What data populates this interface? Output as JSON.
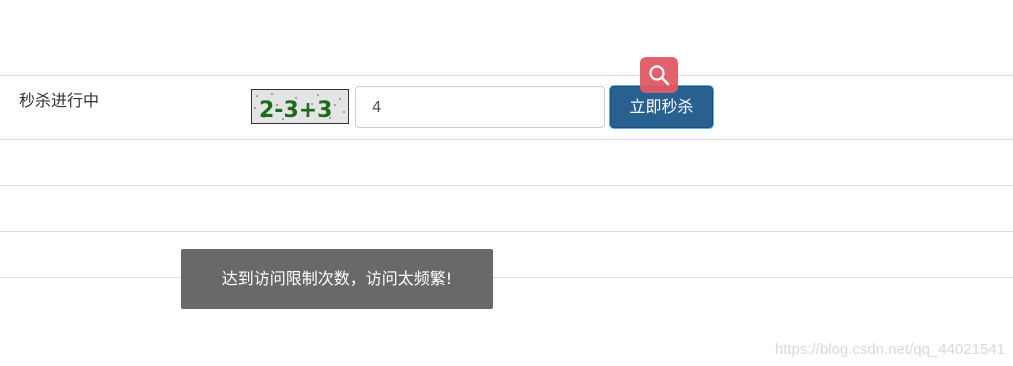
{
  "seckill": {
    "status_text": "秒杀进行中",
    "captcha_text": "2-3+3",
    "captcha_input_value": "4",
    "buy_button_label": "立即秒杀"
  },
  "toast": {
    "message": "达到访问限制次数，访问太频繁!"
  },
  "watermark": "https://blog.csdn.net/qq_44021541",
  "icons": {
    "floating_badge": "search-icon"
  },
  "colors": {
    "primary_button": "#286090",
    "badge": "#e05a66",
    "toast_bg": "#484848"
  }
}
